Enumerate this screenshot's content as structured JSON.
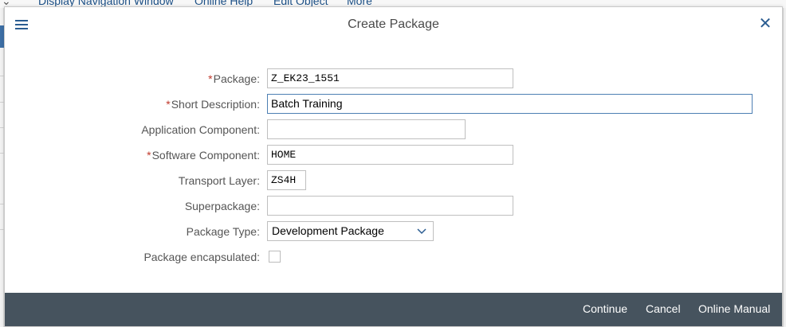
{
  "background": {
    "toolbar_items": [
      "Display Navigation Window",
      "Online Help",
      "Edit Object",
      "More"
    ]
  },
  "dialog": {
    "title": "Create Package",
    "fields": {
      "package": {
        "label": "Package:",
        "value": "Z_EK23_1551",
        "required": true
      },
      "short_description": {
        "label": "Short Description:",
        "value": "Batch Training",
        "required": true
      },
      "application_component": {
        "label": "Application Component:",
        "value": "",
        "required": false
      },
      "software_component": {
        "label": "Software Component:",
        "value": "HOME",
        "required": true
      },
      "transport_layer": {
        "label": "Transport Layer:",
        "value": "ZS4H",
        "required": false
      },
      "superpackage": {
        "label": "Superpackage:",
        "value": "",
        "required": false
      },
      "package_type": {
        "label": "Package Type:",
        "value": "Development Package",
        "required": false
      },
      "package_encapsulated": {
        "label": "Package encapsulated:",
        "checked": false,
        "required": false
      }
    },
    "footer": {
      "continue_label": "Continue",
      "cancel_label": "Cancel",
      "online_manual_label": "Online Manual"
    }
  },
  "icons": {
    "menu": "menu-icon",
    "close": "close-icon",
    "dropdown": "chevron-down-icon"
  },
  "colors": {
    "accent": "#2a5c91",
    "footer_bg": "#46535e",
    "required": "#c0392b"
  }
}
